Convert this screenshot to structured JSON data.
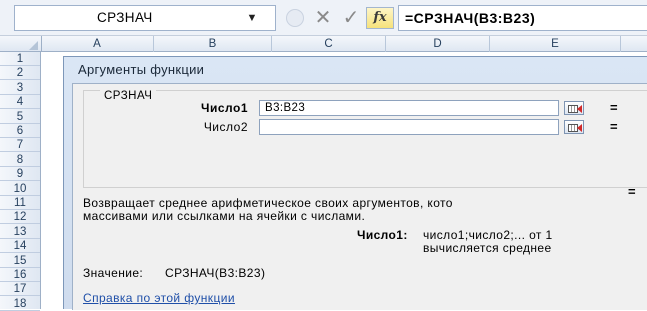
{
  "formula_bar": {
    "name_box": "СРЗНАЧ",
    "name_box_arrow": "▼",
    "cancel_glyph": "✕",
    "enter_glyph": "✓",
    "fx_label": "fx",
    "formula": "=СРЗНАЧ(B3:B23)"
  },
  "columns": [
    "A",
    "B",
    "C",
    "D",
    "E"
  ],
  "rows": [
    "1",
    "2",
    "3",
    "4",
    "5",
    "6",
    "7",
    "8",
    "9",
    "10",
    "11",
    "12",
    "13",
    "14",
    "15",
    "16",
    "17",
    "18"
  ],
  "dialog": {
    "title": "Аргументы функции",
    "function_name": "СРЗНАЧ",
    "args": [
      {
        "label": "Число1",
        "value": "B3:B23",
        "eq": "="
      },
      {
        "label": "Число2",
        "value": "",
        "eq": "="
      }
    ],
    "result_eq": "=",
    "description_line1": "Возвращает среднее арифметическое своих аргументов, кото",
    "description_line2": "массивами или ссылками на ячейки с числами.",
    "arg_help_label": "Число1:",
    "arg_help_line1": "число1;число2;... от 1",
    "arg_help_line2": "вычисляется среднее",
    "value_label": "Значение:",
    "value_text": "СРЗНАЧ(B3:B23)",
    "help_link": "Справка по этой функции"
  },
  "colors": {
    "accent_link": "#1f4fa8",
    "dialog_title_bg": "#dae6f5",
    "fx_button": "#f6e27a"
  },
  "icons": [
    "chevron-down-icon",
    "cancel-icon",
    "enter-icon",
    "fx-icon",
    "collapse-dialog-icon"
  ]
}
